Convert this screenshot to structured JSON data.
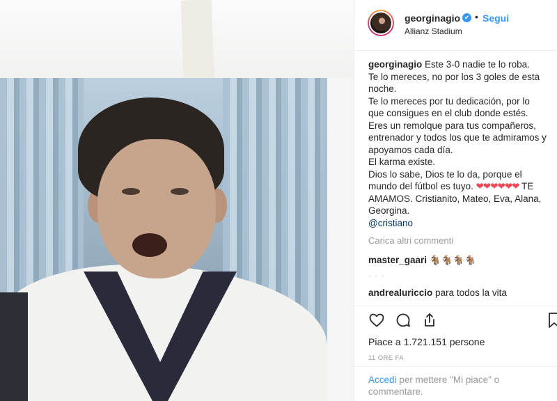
{
  "post": {
    "username": "georginagio",
    "verified_badge": "✔",
    "separator": "•",
    "follow_label": "Segui",
    "location": "Allianz Stadium"
  },
  "caption": {
    "author": "georginagio",
    "lines": [
      "Este 3-0 nadie te lo roba.",
      "Te lo mereces, no por los 3 goles de esta noche.",
      "Te lo mereces por tu dedicación, por lo que consigues en el club donde estés. Eres un remolque para tus compañeros, entrenador y todos los que te admiramos y apoyamos cada día.",
      "El karma existe.",
      "Dios lo sabe, Dios te lo da, porque el mundo del fútbol es tuyo."
    ],
    "hearts": "❤❤❤❤❤❤",
    "closing": " TE AMAMOS. Cristianito, Mateo, Eva, Alana, Georgina.",
    "mention": "@cristiano"
  },
  "load_more": "Carica altri commenti",
  "comments": [
    {
      "user": "master_gaari",
      "text": " 🐐🐐🐐🐐"
    },
    {
      "user": "andrealuriccio",
      "text": " para todos la vita"
    }
  ],
  "likes_text": "Piace a 1.721.151 persone",
  "time_ago": "11 ORE FA",
  "login_prompt": {
    "link": "Accedi",
    "rest": " per mettere \"Mi piace\" o commentare."
  },
  "icons": [
    "heart-icon",
    "comment-icon",
    "share-icon",
    "bookmark-icon",
    "verified-icon"
  ],
  "colors": {
    "link": "#3897f0",
    "muted": "#999999",
    "text": "#262626"
  }
}
